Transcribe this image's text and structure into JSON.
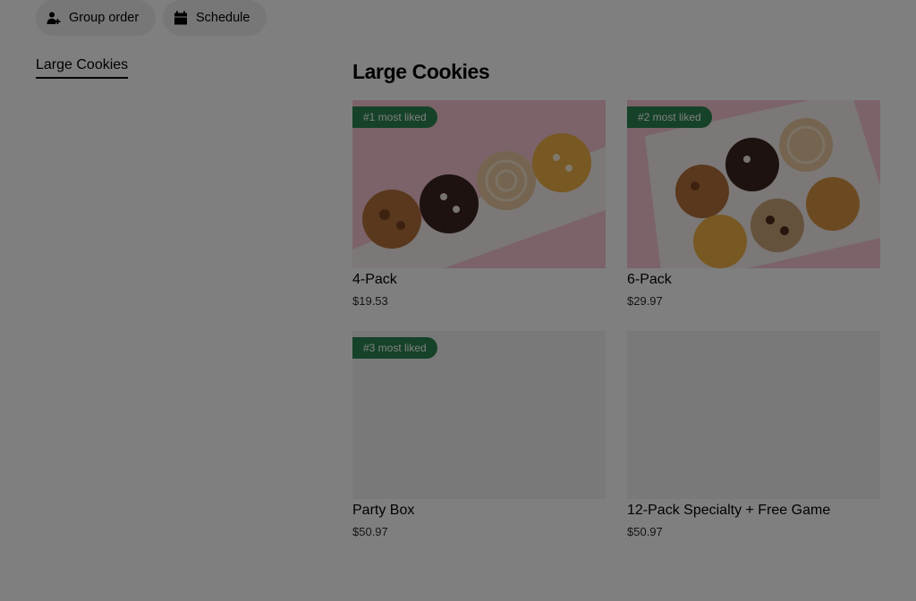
{
  "actions": {
    "group_order_label": "Group order",
    "schedule_label": "Schedule"
  },
  "sidebar": {
    "categories": [
      {
        "label": "Large Cookies",
        "selected": true
      }
    ]
  },
  "section": {
    "title": "Large Cookies"
  },
  "products": [
    {
      "name": "4-Pack",
      "price": "$19.53",
      "badge": "#1 most liked",
      "image": "cookie-box-4"
    },
    {
      "name": "6-Pack",
      "price": "$29.97",
      "badge": "#2 most liked",
      "image": "cookie-box-6"
    },
    {
      "name": "Party Box",
      "price": "$50.97",
      "badge": "#3 most liked",
      "image": "placeholder"
    },
    {
      "name": "12-Pack Specialty + Free Game",
      "price": "$50.97",
      "badge": "",
      "image": "placeholder"
    }
  ],
  "colors": {
    "badge_green": "#2b8550",
    "pill_background": "#eeeeee",
    "image_pink": "#f7c6d3",
    "overlay": "rgba(0,0,0,0.5)"
  }
}
